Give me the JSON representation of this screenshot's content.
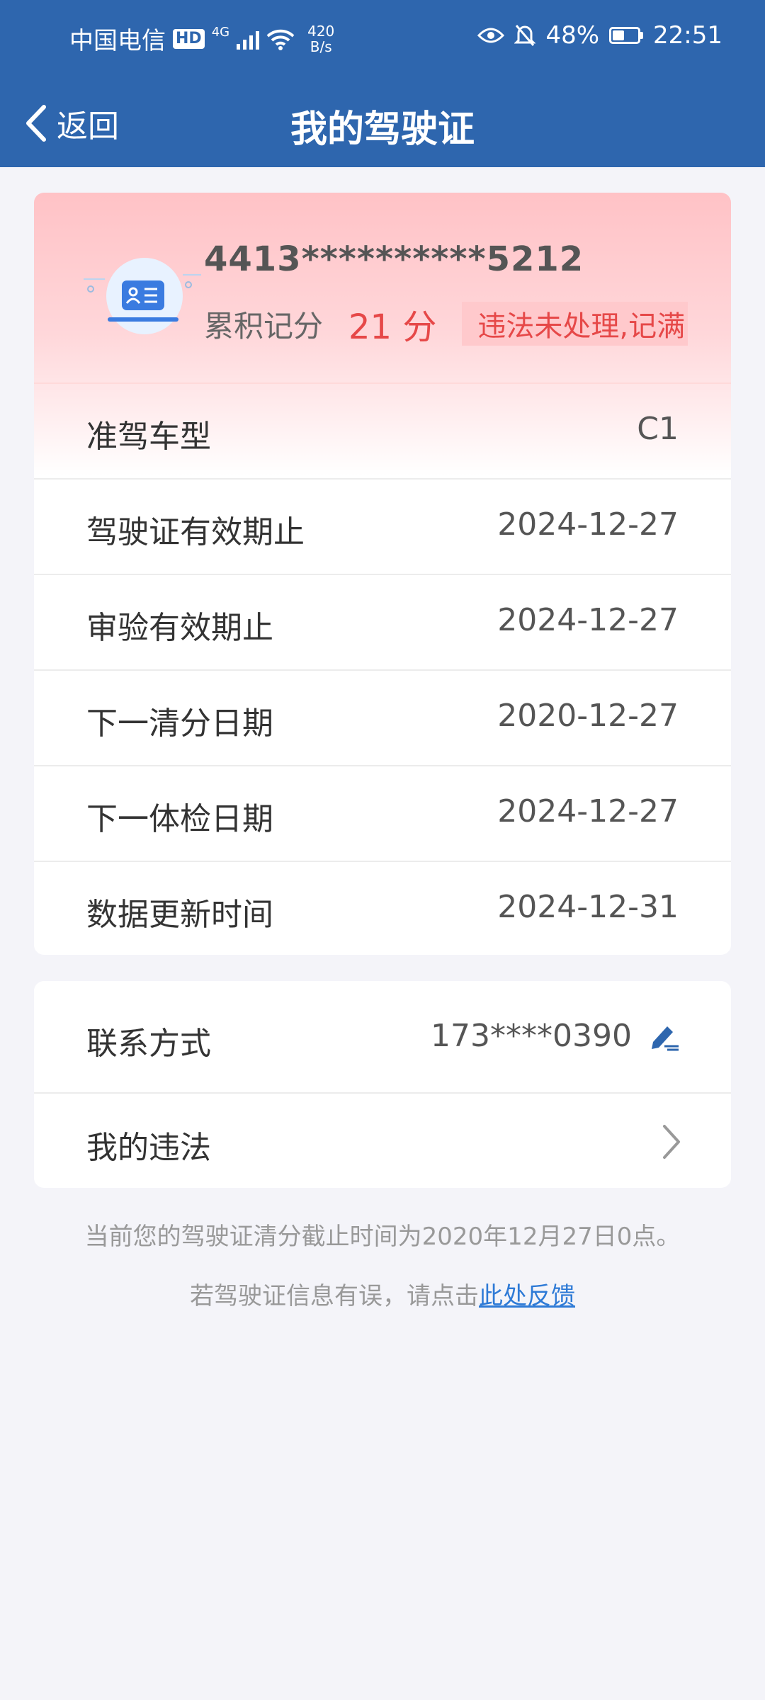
{
  "status_bar": {
    "carrier": "中国电信",
    "hd": "HD",
    "network": "4G",
    "speed_value": "420",
    "speed_unit": "B/s",
    "battery": "48%",
    "battery_level": 0.48,
    "time": "22:51"
  },
  "nav": {
    "back_label": "返回",
    "title": "我的驾驶证"
  },
  "license": {
    "number": "4413**********5212",
    "points_label": "累积记分",
    "points_value": "21 分",
    "status_badge": "违法未处理,记满"
  },
  "details": [
    {
      "label": "准驾车型",
      "value": "C1"
    },
    {
      "label": "驾驶证有效期止",
      "value": "2024-12-27"
    },
    {
      "label": "审验有效期止",
      "value": "2024-12-27"
    },
    {
      "label": "下一清分日期",
      "value": "2020-12-27"
    },
    {
      "label": "下一体检日期",
      "value": "2024-12-27"
    },
    {
      "label": "数据更新时间",
      "value": "2024-12-31"
    }
  ],
  "contact": {
    "label": "联系方式",
    "phone": "173****0390"
  },
  "violations": {
    "label": "我的违法"
  },
  "footer": {
    "note": "当前您的驾驶证清分截止时间为2020年12月27日0点。",
    "feedback_prefix": "若驾驶证信息有误，请点击",
    "feedback_link": "此处反馈"
  },
  "colors": {
    "header": "#2e66ae",
    "accent_red": "#e64848",
    "link": "#2e7ad6"
  }
}
